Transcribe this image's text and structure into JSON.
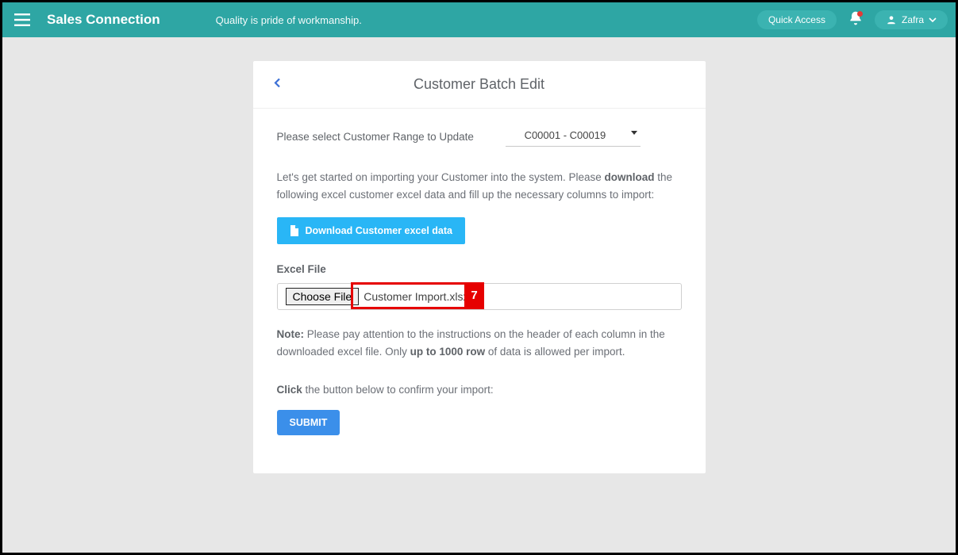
{
  "header": {
    "brand": "Sales Connection",
    "tagline": "Quality is pride of workmanship.",
    "quick_access": "Quick Access",
    "user_name": "Zafra"
  },
  "card": {
    "title": "Customer Batch Edit",
    "range": {
      "label": "Please select Customer Range to Update",
      "value": "C00001 - C00019"
    },
    "intro_1": "Let's get started on importing your Customer into the system. Please ",
    "intro_bold": "download",
    "intro_2": " the following excel customer excel data and fill up the necessary columns to import:",
    "download_btn": "Download Customer excel data",
    "file_label": "Excel File",
    "choose_file": "Choose File",
    "filename": "Customer Import.xlsx",
    "annotation_number": "7",
    "note_bold": "Note:",
    "note_1": " Please pay attention to the instructions on the header of each column in the downloaded excel file. Only ",
    "note_bold2": "up to 1000 row",
    "note_2": " of data is allowed per import.",
    "click_bold": "Click",
    "click_text": " the button below to confirm your import:",
    "submit": "SUBMIT"
  }
}
